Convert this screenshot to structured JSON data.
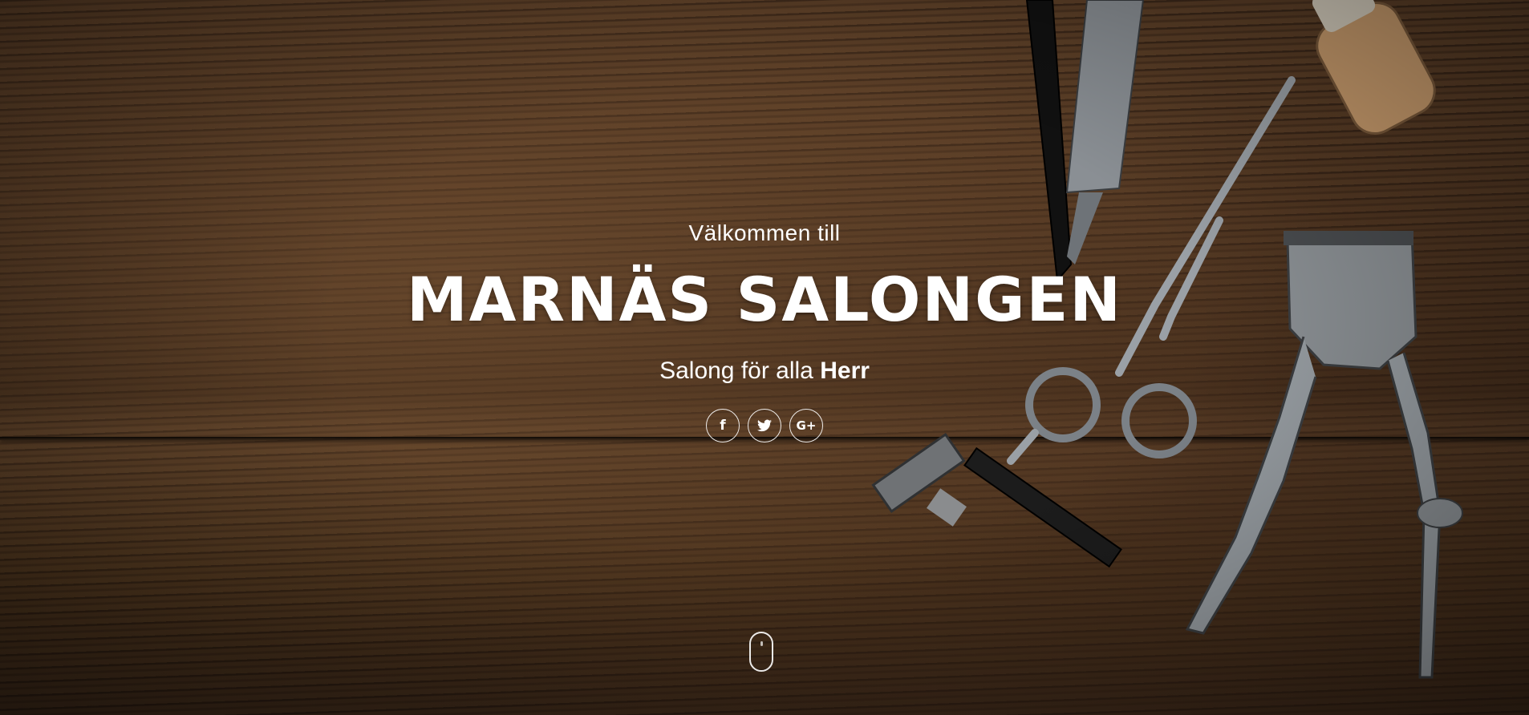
{
  "hero": {
    "welcome": "Välkommen till",
    "title": "MARNÄS SALONGEN",
    "tagline_prefix": "Salong för alla ",
    "tagline_emphasis": "Herr"
  },
  "social": [
    {
      "name": "facebook",
      "glyph": "f",
      "icon": "facebook-icon"
    },
    {
      "name": "twitter",
      "glyph": "🐦",
      "icon": "twitter-icon"
    },
    {
      "name": "google-plus",
      "glyph": "G+",
      "icon": "google-plus-icon"
    }
  ],
  "scroll_indicator": {
    "icon": "mouse-scroll-icon"
  },
  "colors": {
    "text": "#ffffff",
    "wood_dark": "#2f1f13",
    "wood_mid": "#5a3d26"
  }
}
